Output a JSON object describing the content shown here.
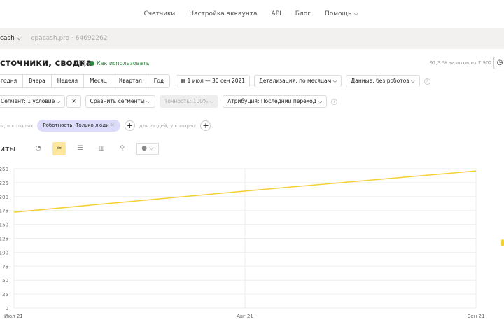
{
  "topnav": {
    "items": [
      "Счетчики",
      "Настройка аккаунта",
      "API",
      "Блог",
      "Помощь ⌵"
    ]
  },
  "counter": {
    "name": "cash ⌵",
    "site": "cpacash.pro · 64692262"
  },
  "report": {
    "title": "сточники, сводка",
    "howto": "Как использовать",
    "visits": "91,3 % визитов из 7 902"
  },
  "periods": [
    "годня",
    "Вчера",
    "Неделя",
    "Месяц",
    "Квартал",
    "Год"
  ],
  "date_range": "1 июл — 30 сен 2021",
  "detail": "Детализация: по месяцам ⌵",
  "data_filter": "Данные: без роботов ⌵",
  "segment": "Сегмент: 1 условие ⌵",
  "segment_clear": "✕",
  "compare": "Сравнить сегменты ⌵",
  "accuracy": "Точность: 100% ⌵",
  "attribution": "Атрибуция: Последний переход ⌵",
  "filter": {
    "prefix": "ты, в которых",
    "chip": "Роботность: Только люди",
    "middle": "для людей, у которых"
  },
  "chart_title": "иты",
  "chart_data": {
    "type": "line",
    "x": [
      "Июл 21",
      "Авг 21",
      "Сен 21"
    ],
    "values": [
      172,
      210,
      246
    ],
    "ylim": [
      0,
      250
    ],
    "yticks": [
      0,
      25,
      50,
      75,
      100,
      125,
      150,
      175,
      200,
      225,
      250
    ],
    "color": "#f5d033",
    "grid": true
  }
}
